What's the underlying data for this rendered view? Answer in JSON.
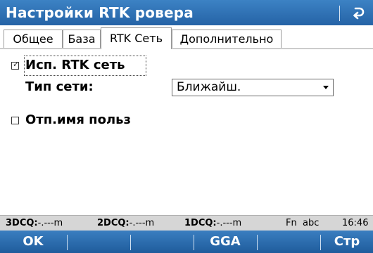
{
  "title": "Настройки RTK ровера",
  "tabs": [
    "Общее",
    "База",
    "RTK Сеть",
    "Дополнительно"
  ],
  "form": {
    "use_rtk_label": "Исп.  RTK сеть",
    "use_rtk_checked": true,
    "network_type_label": "Тип сети:",
    "network_type_value": "Ближайш.",
    "show_user_label": "Отп.имя польз",
    "show_user_checked": false
  },
  "status": {
    "dcq3_label": "3DCQ:",
    "dcq3_value": "-.---m",
    "dcq2_label": "2DCQ:",
    "dcq2_value": "-.---m",
    "dcq1_label": "1DCQ:",
    "dcq1_value": "-.---m",
    "fn": "Fn",
    "input_mode": "abc",
    "time": "16:46"
  },
  "softkeys": {
    "ok": "OK",
    "gga": "GGA",
    "page": "Стр"
  },
  "icons": {
    "back": "back-arrow-icon",
    "dropdown": "dropdown-arrow-icon",
    "checkbox_check": "checkmark-icon"
  },
  "colors": {
    "header_blue": "#2b6fb0",
    "statusbar_gray": "#d6d6d6"
  }
}
